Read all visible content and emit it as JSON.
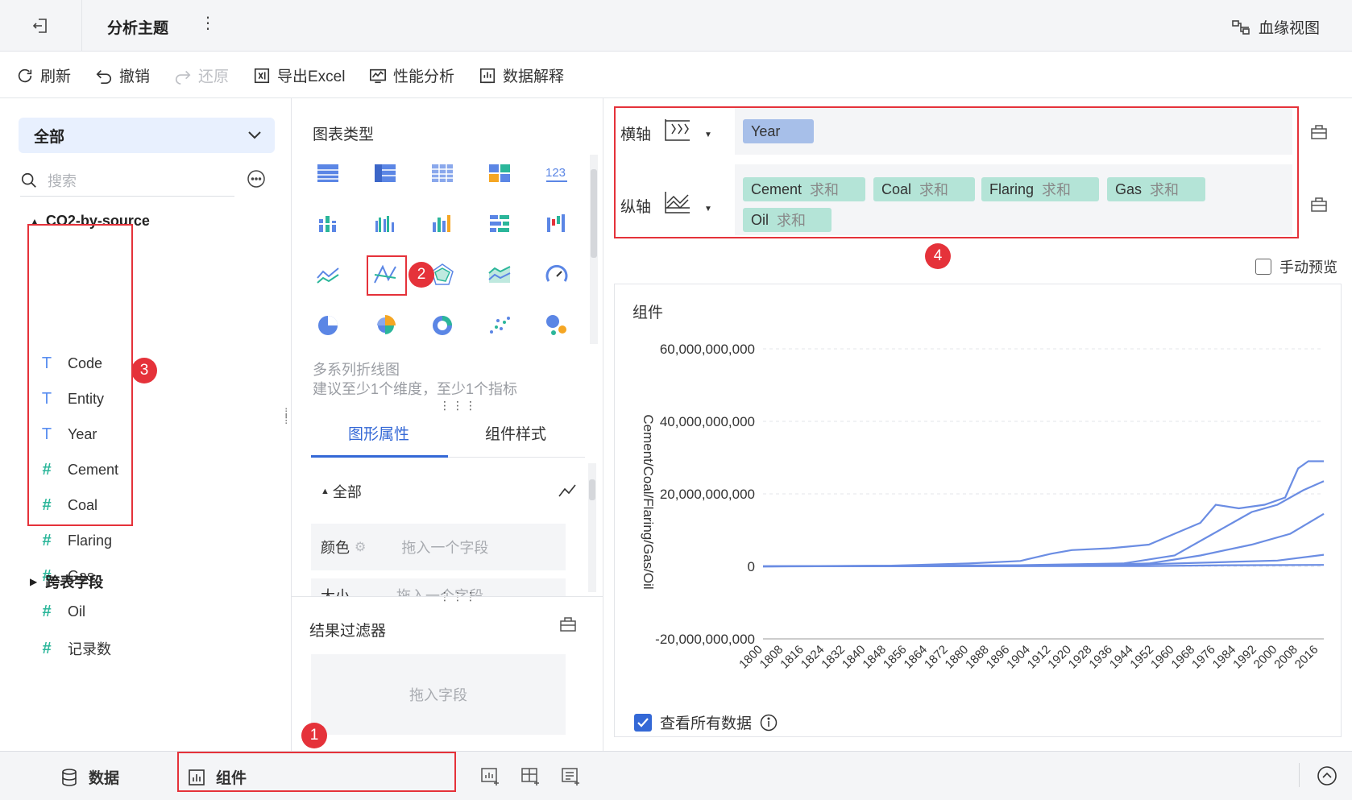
{
  "topbar": {
    "title": "分析主题",
    "more": "⋮",
    "lineage": "血缘视图"
  },
  "toolbar": {
    "refresh": "刷新",
    "undo": "撤销",
    "redo": "还原",
    "export": "导出Excel",
    "perf": "性能分析",
    "explain": "数据解释"
  },
  "left": {
    "dropdown": "全部",
    "search_placeholder": "搜索",
    "dataset": "CO2-by-source",
    "fields": [
      {
        "type": "text",
        "name": "Code"
      },
      {
        "type": "text",
        "name": "Entity"
      },
      {
        "type": "text",
        "name": "Year"
      },
      {
        "type": "number",
        "name": "Cement"
      },
      {
        "type": "number",
        "name": "Coal"
      },
      {
        "type": "number",
        "name": "Flaring"
      },
      {
        "type": "number",
        "name": "Gas"
      },
      {
        "type": "number",
        "name": "Oil"
      },
      {
        "type": "number",
        "name": "记录数"
      }
    ],
    "cross_table": "跨表字段"
  },
  "mid": {
    "chart_type_title": "图表类型",
    "chart_name": "多系列折线图",
    "chart_hint": "建议至少1个维度，至少1个指标",
    "tab_graph": "图形属性",
    "tab_style": "组件样式",
    "section_all": "全部",
    "color_label": "颜色",
    "color_placeholder": "拖入一个字段",
    "size_label": "大小",
    "size_placeholder": "拖入一个字段",
    "filter_title": "结果过滤器",
    "filter_placeholder": "拖入字段"
  },
  "axes": {
    "x_label": "横轴",
    "y_label": "纵轴",
    "x_fields": [
      {
        "name": "Year"
      }
    ],
    "y_fields": [
      {
        "name": "Cement",
        "agg": "求和"
      },
      {
        "name": "Coal",
        "agg": "求和"
      },
      {
        "name": "Flaring",
        "agg": "求和"
      },
      {
        "name": "Gas",
        "agg": "求和"
      },
      {
        "name": "Oil",
        "agg": "求和"
      }
    ]
  },
  "manual_preview": "手动预览",
  "chart_card": {
    "title": "组件",
    "view_all": "查看所有数据"
  },
  "bottom": {
    "data": "数据",
    "component": "组件"
  },
  "badges": [
    "1",
    "2",
    "3",
    "4"
  ],
  "colors": {
    "accent": "#3468d6",
    "red": "#e5323a",
    "line": "#6b8de3"
  },
  "chart_data": {
    "type": "line",
    "title": "",
    "xlabel": "",
    "ylabel": "Cement/Coal/Flaring/Gas/Oil",
    "ylim": [
      -20000000000,
      60000000000
    ],
    "yticks": [
      "60,000,000,000",
      "40,000,000,000",
      "20,000,000,000",
      "0",
      "-20,000,000,000"
    ],
    "xtick_labels": [
      "1800",
      "1808",
      "1816",
      "1824",
      "1832",
      "1840",
      "1848",
      "1856",
      "1864",
      "1872",
      "1880",
      "1888",
      "1896",
      "1904",
      "1912",
      "1920",
      "1928",
      "1936",
      "1944",
      "1952",
      "1960",
      "1968",
      "1976",
      "1984",
      "1992",
      "2000",
      "2008",
      "2016"
    ],
    "xlim": [
      1800,
      2018
    ],
    "series": [
      {
        "points": [
          [
            1800,
            0
          ],
          [
            1850,
            200000000
          ],
          [
            1880,
            800000000
          ],
          [
            1900,
            1500000000
          ],
          [
            1912,
            3500000000
          ],
          [
            1920,
            4500000000
          ],
          [
            1935,
            5000000000
          ],
          [
            1950,
            6000000000
          ],
          [
            1960,
            9000000000
          ],
          [
            1970,
            12000000000
          ],
          [
            1976,
            17000000000
          ],
          [
            1985,
            16000000000
          ],
          [
            1995,
            17000000000
          ],
          [
            2003,
            19000000000
          ],
          [
            2008,
            27000000000
          ],
          [
            2012,
            29000000000
          ],
          [
            2018,
            29000000000
          ]
        ]
      },
      {
        "points": [
          [
            1800,
            0
          ],
          [
            1900,
            300000000
          ],
          [
            1940,
            800000000
          ],
          [
            1960,
            3000000000
          ],
          [
            1975,
            9000000000
          ],
          [
            1990,
            15000000000
          ],
          [
            2000,
            17000000000
          ],
          [
            2010,
            21000000000
          ],
          [
            2018,
            23500000000
          ]
        ]
      },
      {
        "points": [
          [
            1800,
            0
          ],
          [
            1920,
            200000000
          ],
          [
            1950,
            800000000
          ],
          [
            1970,
            3000000000
          ],
          [
            1990,
            6000000000
          ],
          [
            2005,
            9000000000
          ],
          [
            2018,
            14500000000
          ]
        ]
      },
      {
        "points": [
          [
            1800,
            0
          ],
          [
            1900,
            100000000
          ],
          [
            1950,
            600000000
          ],
          [
            1980,
            1200000000
          ],
          [
            2000,
            1600000000
          ],
          [
            2018,
            3200000000
          ]
        ]
      },
      {
        "points": [
          [
            1800,
            0
          ],
          [
            1950,
            100000000
          ],
          [
            1980,
            300000000
          ],
          [
            2018,
            400000000
          ]
        ]
      }
    ]
  }
}
